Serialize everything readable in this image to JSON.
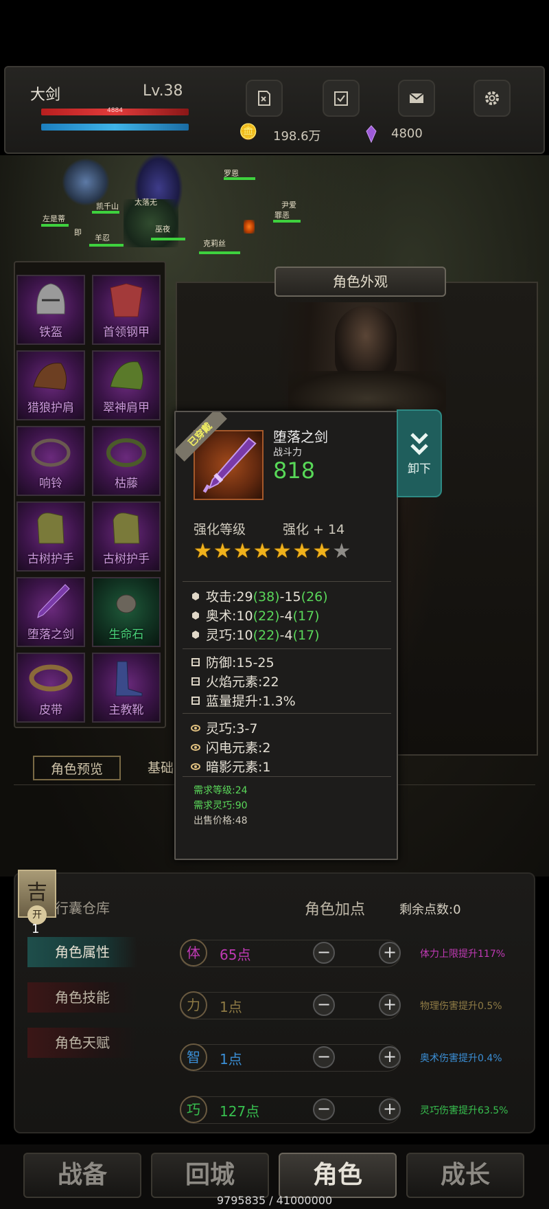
{
  "hud": {
    "name": "大剑",
    "level": "Lv.38",
    "hp_text": "4884",
    "gold": "198.6万",
    "gems": "4800",
    "icons": [
      "quest-icon",
      "checklist-icon",
      "mail-icon",
      "settings-icon"
    ]
  },
  "scene_npcs": [
    "左是蒂",
    "即",
    "羊忍",
    "凯千山",
    "太落无",
    "巫夜",
    "尹爱",
    "罪恶",
    "克莉丝",
    "罗恩"
  ],
  "equipment": [
    {
      "label": "铁盔",
      "color": "purple"
    },
    {
      "label": "首领钢甲",
      "color": "purple"
    },
    {
      "label": "猎狼护肩",
      "color": "purple"
    },
    {
      "label": "翠神肩甲",
      "color": "purple"
    },
    {
      "label": "响铃",
      "color": "purple"
    },
    {
      "label": "枯藤",
      "color": "purple"
    },
    {
      "label": "古树护手",
      "color": "purple"
    },
    {
      "label": "古树护手",
      "color": "purple"
    },
    {
      "label": "堕落之剑",
      "color": "purple"
    },
    {
      "label": "生命石",
      "color": "green"
    },
    {
      "label": "皮带",
      "color": "purple"
    },
    {
      "label": "主教靴",
      "color": "purple"
    }
  ],
  "appearance": {
    "title": "角色外观",
    "tab_preview": "角色预览",
    "tab_base": "基础"
  },
  "tooltip": {
    "ribbon": "已穿戴",
    "item_name": "堕落之剑",
    "power_label": "战斗力",
    "power_value": "818",
    "enhance_label": "强化等级",
    "enhance_value": "强化 + 14",
    "stars_filled": 7,
    "stars_total": 8,
    "base_stats": [
      {
        "name": "攻击:",
        "v1": "29",
        "b1": "(38)",
        "sep": "-",
        "v2": "15",
        "b2": "(26)"
      },
      {
        "name": "奥术:",
        "v1": "10",
        "b1": "(22)",
        "sep": "-",
        "v2": "4",
        "b2": "(17)"
      },
      {
        "name": "灵巧:",
        "v1": "10",
        "b1": "(22)",
        "sep": "-",
        "v2": "4",
        "b2": "(17)"
      }
    ],
    "extra_stats": [
      "防御:15-25",
      "火焰元素:22",
      "蓝量提升:1.3%"
    ],
    "socket_stats": [
      "灵巧:3-7",
      "闪电元素:2",
      "暗影元素:1"
    ],
    "req_level": "需求等级:24",
    "req_dex": "需求灵巧:90",
    "sell_price": "出售价格:48",
    "unequip_label": "卸下"
  },
  "bottom": {
    "badge_char": "吉",
    "badge_sub": "开",
    "badge_num": "1",
    "bag_label": "行囊仓库",
    "panel_title": "角色加点",
    "remaining": "剩余点数:0",
    "side_buttons": [
      "角色属性",
      "角色技能",
      "角色天赋"
    ],
    "attributes": [
      {
        "char": "体",
        "value": "65点",
        "effect": "体力上限提升117%",
        "color": "#c03ab5"
      },
      {
        "char": "力",
        "value": "1点",
        "effect": "物理伤害提升0.5%",
        "color": "#8f7b45"
      },
      {
        "char": "智",
        "value": "1点",
        "effect": "奥术伤害提升0.4%",
        "color": "#3b8fd6"
      },
      {
        "char": "巧",
        "value": "127点",
        "effect": "灵巧伤害提升63.5%",
        "color": "#37c04f"
      }
    ]
  },
  "nav": {
    "items": [
      "战备",
      "回城",
      "角色",
      "成长"
    ],
    "active_index": 2,
    "exp_text": "9795835 / 41000000"
  }
}
